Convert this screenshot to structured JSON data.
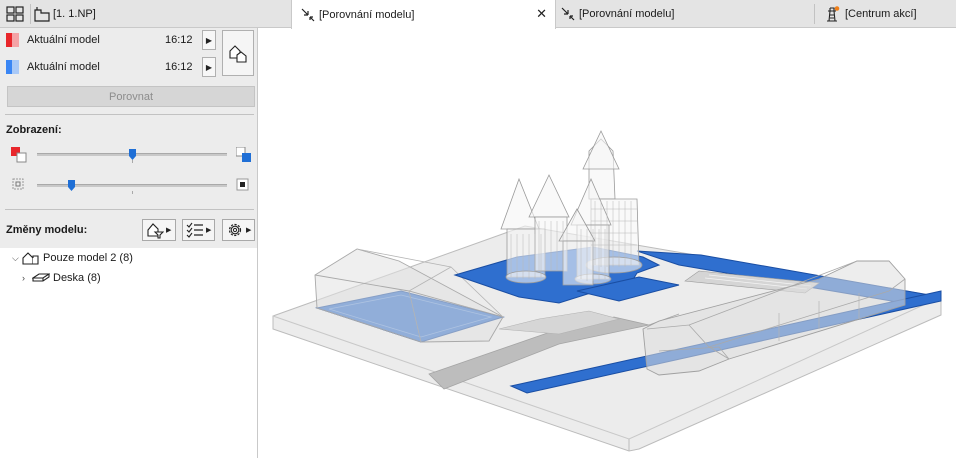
{
  "tabs": [
    {
      "label": "[1. 1.NP]"
    },
    {
      "label": "[Porovnání modelu]",
      "active": true
    },
    {
      "label": "[Porovnání modelu]"
    },
    {
      "label": "[Centrum akcí]"
    }
  ],
  "tab_close": "✕",
  "models": [
    {
      "name": "Aktuální model",
      "time": "16:12",
      "color": "#e8262b"
    },
    {
      "name": "Aktuální model",
      "time": "16:12",
      "color": "#3a86f4"
    }
  ],
  "compare_button": "Porovnat",
  "display": {
    "label": "Zobrazení:",
    "color_slider": 0.46,
    "opacity_slider": 0.18
  },
  "changes": {
    "label": "Změny modelu:"
  },
  "tree": [
    {
      "label": "Pouze model 2 (8)",
      "level": 0,
      "expanded": true
    },
    {
      "label": "Deska (8)",
      "level": 1,
      "expanded": false
    }
  ],
  "colors": {
    "accent_blue": "#2f6fcf",
    "model1": "#e8262b",
    "model2": "#3a86f4",
    "notification": "#f07f1a"
  },
  "icons": [
    "grid-icon",
    "floor-plan-icon",
    "compare-icon",
    "tower-icon",
    "swap-icon",
    "filter-icon",
    "list-icon",
    "settings-icon",
    "building-icon",
    "slab-icon"
  ]
}
